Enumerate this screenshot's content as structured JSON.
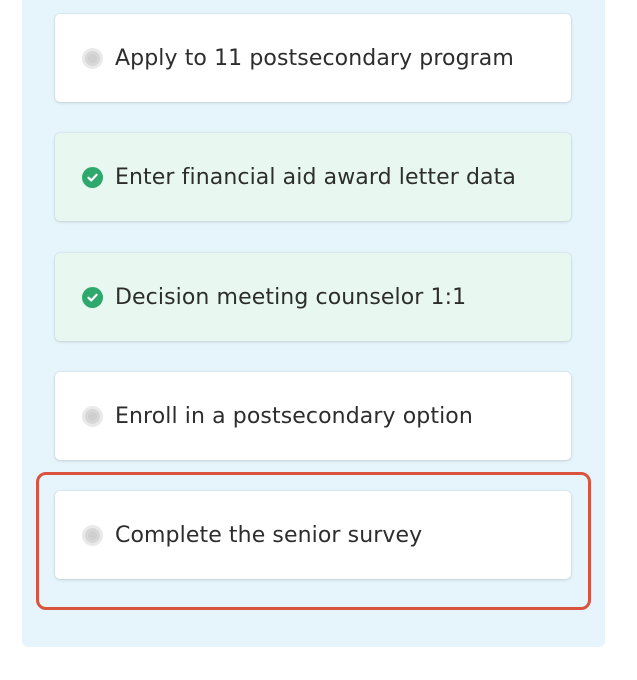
{
  "tasks": [
    {
      "label": "Apply to 11 postsecondary program",
      "status": "pending",
      "icon": "pending-circle-icon"
    },
    {
      "label": "Enter financial aid award letter data",
      "status": "complete",
      "icon": "check-circle-icon"
    },
    {
      "label": "Decision meeting counselor 1:1",
      "status": "complete",
      "icon": "check-circle-icon"
    },
    {
      "label": "Enroll in a postsecondary option",
      "status": "pending",
      "icon": "pending-circle-icon"
    },
    {
      "label": "Complete the senior survey",
      "status": "pending",
      "icon": "pending-circle-icon"
    }
  ],
  "colors": {
    "panel_background": "#e6f4fb",
    "complete_background": "#e8f8f1",
    "check_green": "#2fa86d",
    "highlight_red": "#d9533f"
  }
}
